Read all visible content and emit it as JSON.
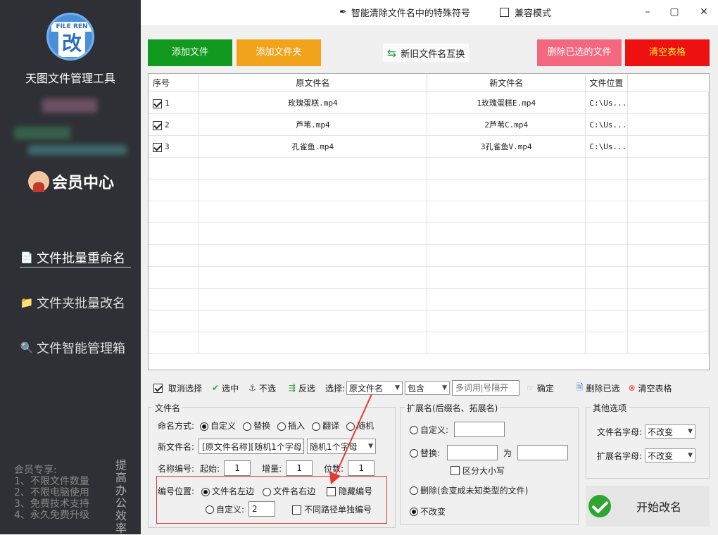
{
  "sidebar": {
    "logo_tag": "FILE REN",
    "logo_char": "改",
    "app_title": "天图文件管理工具",
    "member_center": "会员中心",
    "nav": [
      {
        "label": "文件批量重命名"
      },
      {
        "label": "文件夹批量改名"
      },
      {
        "label": "文件智能管理箱"
      }
    ],
    "promo_lines": [
      "会员专享:",
      "1、不限文件数量",
      "2、不限电脑使用",
      "3、免费技术支持",
      "4、永久免费升级"
    ],
    "promo_vertical": "提高办公效率"
  },
  "topbar": {
    "title": "智能清除文件名中的特殊符号",
    "compat": "兼容模式",
    "min": "–",
    "max": "▢",
    "close": "✕"
  },
  "buttons": {
    "add_file": "添加文件",
    "add_folder": "添加文件夹",
    "swap": "新旧文件名互换",
    "delete_selected": "删除已选的文件",
    "clear_table": "清空表格"
  },
  "colors": {
    "add_file": "#119a1d",
    "add_folder": "#f2a31c",
    "delete_selected": "#f3687f",
    "clear_table": "#ee1111",
    "clear_table_text": "#ffee33"
  },
  "table": {
    "headers": [
      "序号",
      "原文件名",
      "新文件名",
      "文件位置"
    ],
    "rows": [
      {
        "no": "1",
        "orig": "玫瑰蛋糕.mp4",
        "new": "1玫瑰蛋糕E.mp4",
        "loc": "C:\\Us..."
      },
      {
        "no": "2",
        "orig": "芦苇.mp4",
        "new": "2芦苇C.mp4",
        "loc": "C:\\Us..."
      },
      {
        "no": "3",
        "orig": "孔雀鱼.mp4",
        "new": "3孔雀鱼V.mp4",
        "loc": "C:\\Us..."
      }
    ]
  },
  "toolbar": {
    "cancel_select": "取消选择",
    "select": "选中",
    "unselect": "不选",
    "invert": "反选",
    "choose": "选择:",
    "field": "原文件名",
    "match": "包含",
    "keyword_placeholder": "多词用|号隔开",
    "confirm": "确定",
    "delete_selected": "删除已选",
    "clear_table": "清空表格"
  },
  "filename": {
    "title": "文件名",
    "mode_label": "命名方式:",
    "modes": [
      "自定义",
      "替换",
      "插入",
      "翻译",
      "随机"
    ],
    "newname_label": "新文件名:",
    "newname_value": "[原文件名称][随机1个字母]",
    "newname_select": "随机1个字母",
    "number_label": "名称编号:",
    "start_label": "起始:",
    "start_value": "1",
    "inc_label": "增量:",
    "inc_value": "1",
    "digits_label": "位数:",
    "digits_value": "1",
    "pos_label": "编号位置:",
    "pos_left": "文件名左边",
    "pos_right": "文件名右边",
    "hide_num": "隐藏编号",
    "custom_label": "自定义:",
    "custom_value": "2",
    "separate": "不同路径单独编号"
  },
  "ext": {
    "title": "扩展名(后缀名、拓展名)",
    "custom": "自定义:",
    "replace": "替换:",
    "to": "为",
    "case": "区分大小写",
    "delete": "删除(会变成未知类型的文件)",
    "unchanged": "不改变"
  },
  "other": {
    "title": "其他选项",
    "fname_letter": "文件名字母:",
    "fname_value": "不改变",
    "ext_letter": "扩展名字母:",
    "ext_value": "不改变"
  },
  "start": {
    "label": "开始改名"
  }
}
